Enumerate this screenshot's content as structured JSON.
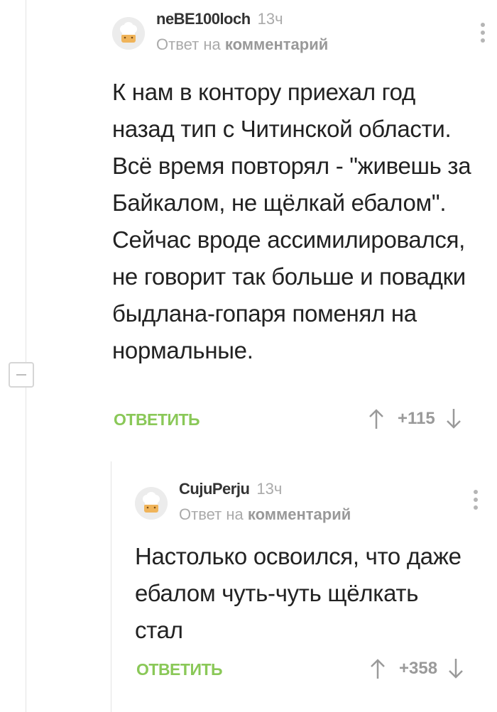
{
  "comments": [
    {
      "username": "neBE100loch",
      "time": "13ч",
      "reply_prefix": "Ответ на",
      "reply_target": "комментарий",
      "text": "К нам в контору приехал год назад тип с Читинской области. Всё время повторял - \"живешь за Байкалом, не щёлкай ебалом\". Сейчас вроде ассимилировался, не говорит так больше и повадки быдлана-гопаря поменял на нормальные.",
      "reply_label": "ОТВЕТИТЬ",
      "score": "+115"
    },
    {
      "username": "CujuPerju",
      "time": "13ч",
      "reply_prefix": "Ответ на",
      "reply_target": "комментарий",
      "text": "Настолько освоился, что даже ебалом чуть-чуть щёлкать стал",
      "reply_label": "ОТВЕТИТЬ",
      "score": "+358"
    }
  ],
  "colors": {
    "accent_green": "#8ac858",
    "muted_gray": "#aaaaaa",
    "thread_line": "#e3e3e3"
  },
  "icons": {
    "avatar": "chef-hat-avatar-icon",
    "menu": "kebab-menu-icon",
    "upvote": "arrow-up-icon",
    "downvote": "arrow-down-icon",
    "collapse": "collapse-minus-icon"
  }
}
